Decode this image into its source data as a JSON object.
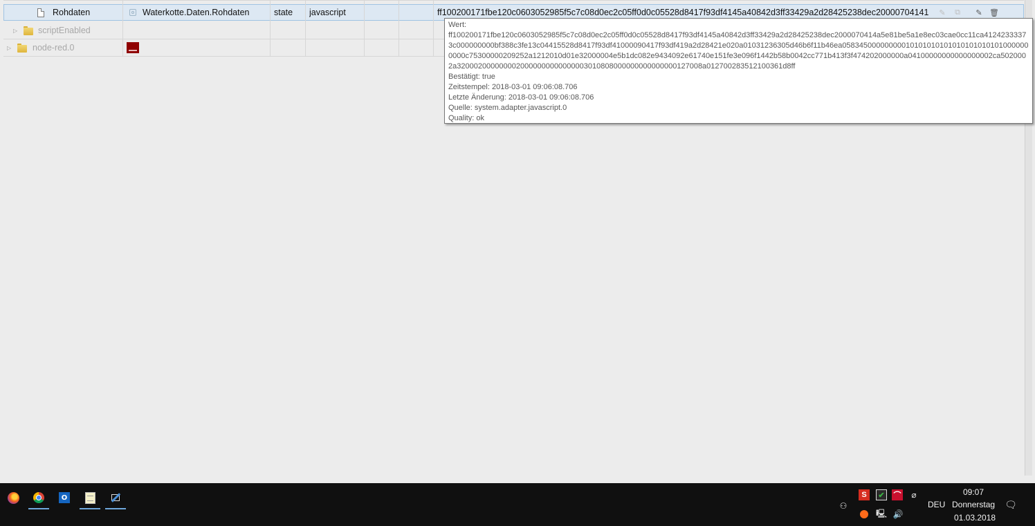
{
  "tree": {
    "selected_row": {
      "name": "Rohdaten",
      "id": "Waterkotte.Daten.Rohdaten",
      "type": "state",
      "role": "javascript",
      "value_preview": "ff100200171fbe120c0603052985f5c7c08d0ec2c05ff0d0c05528d8417f93df4145a40842d3ff33429a2d28425238dec20000704141",
      "icons": {
        "item": "document-icon",
        "state": "state-icon"
      }
    },
    "row_script_enabled": {
      "name": "scriptEnabled",
      "icon": "folder-icon"
    },
    "row_node_red": {
      "name": "node-red.0",
      "icon": "folder-icon",
      "logo": "node-red-logo"
    }
  },
  "row_actions": {
    "edit_faint": "✎",
    "copy_faint": "⧉",
    "edit": "✎",
    "delete": "🗑"
  },
  "tooltip": {
    "wert_label": "Wert:",
    "wert_value": "ff100200171fbe120c0603052985f5c7c08d0ec2c05ff0d0c05528d8417f93df4145a40842d3ff33429a2d28425238dec2000070414a5e81be5a1e8ec03cae0cc11ca41242333373c000000000bf388c3fe13c04415528d8417f93df41000090417f93df419a2d28421e020a01031236305d46b6f11b46ea058345000000000101010101010101010101010000000000c75300000209252a1212010d01e32000004e5b1dc082e9434092e61740e151fe3e096f1442b58b0042cc771b413f3f474202000000a04100000000000000002ca5020002a3200020000000020000000000000003010808000000000000000127008a012700283512100361d8ff",
    "confirmed": "Bestätigt: true",
    "timestamp": "Zeitstempel: 2018-03-01 09:06:08.706",
    "last_change": "Letzte Änderung: 2018-03-01 09:06:08.706",
    "source": "Quelle: system.adapter.javascript.0",
    "quality": "Quality: ok"
  },
  "taskbar": {
    "apps": [
      "firefox-icon",
      "chrome-icon",
      "outlook-icon",
      "notepad-icon",
      "tool-icon"
    ],
    "outlook_glyph": "O",
    "tray": {
      "people_glyph": "⚇",
      "volume_glyph": "🔊",
      "network_glyph": "🖳",
      "notification_glyph": "🗨"
    },
    "language": "DEU",
    "time": "09:07",
    "day": "Donnerstag",
    "date": "01.03.2018"
  },
  "colors": {
    "background": "#ececec",
    "selected_row": "#dde8f3",
    "taskbar": "#101010",
    "node_red": "#8f0000"
  }
}
